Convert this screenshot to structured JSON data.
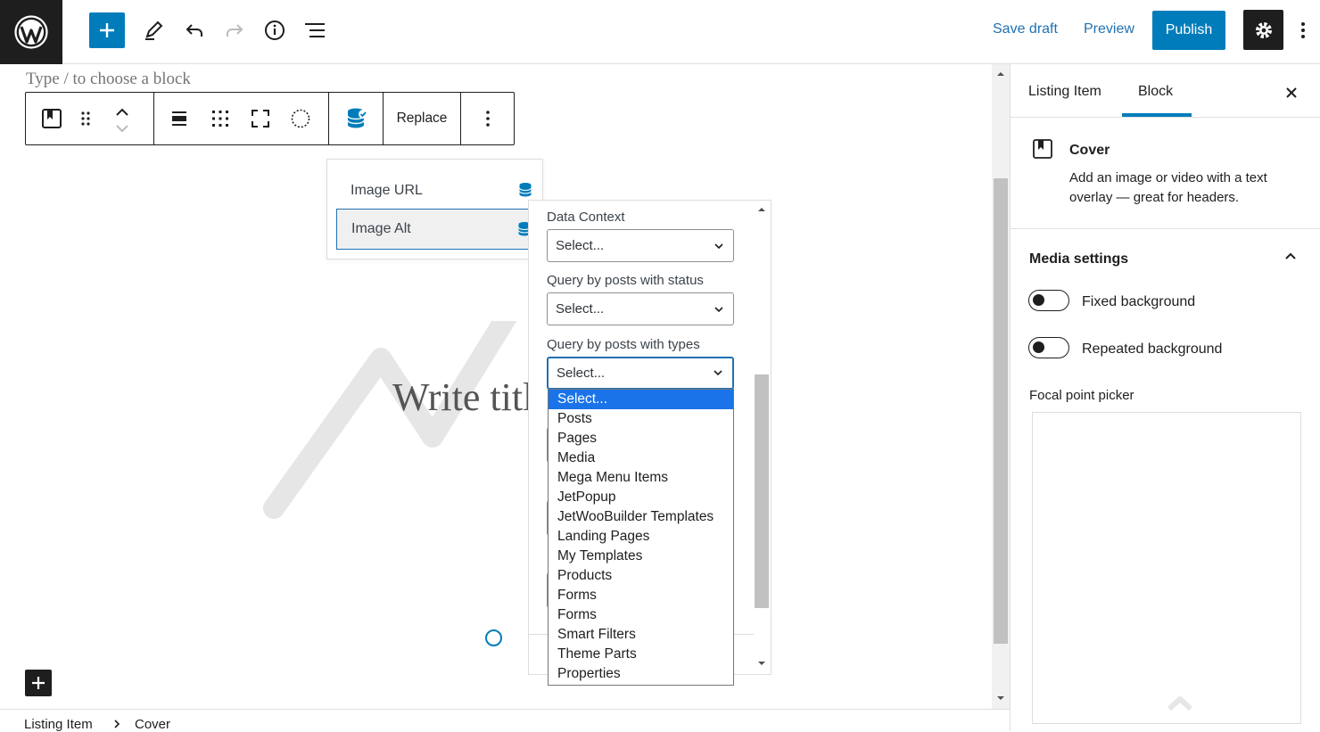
{
  "topbar": {
    "save_draft": "Save draft",
    "preview": "Preview",
    "publish": "Publish",
    "icons": [
      "wordpress-logo",
      "plus-icon",
      "pencil-icon",
      "undo-icon",
      "redo-icon",
      "info-icon",
      "list-view-icon",
      "gear-icon",
      "more-vertical-icon"
    ]
  },
  "editor": {
    "hint": "Type / to choose a block",
    "title_placeholder": "Write title…",
    "toolbar": {
      "replace": "Replace"
    }
  },
  "dynamic_menu": {
    "items": [
      {
        "label": "Image URL",
        "active": false
      },
      {
        "label": "Image Alt",
        "active": true
      }
    ]
  },
  "context_panel": {
    "data_context_label": "Data Context",
    "data_context_value": "Select...",
    "status_label": "Query by posts with status",
    "status_value": "Select...",
    "types_label": "Query by posts with types",
    "types_value": "Select..."
  },
  "dropdown": {
    "options": [
      "Select...",
      "Posts",
      "Pages",
      "Media",
      "Mega Menu Items",
      "JetPopup",
      "JetWooBuilder Templates",
      "Landing Pages",
      "My Templates",
      "Products",
      "Forms",
      "Forms",
      "Smart Filters",
      "Theme Parts",
      "Properties"
    ],
    "selected_index": 0
  },
  "breadcrumb": {
    "items": [
      "Listing Item",
      "Cover"
    ]
  },
  "sidebar": {
    "tabs": [
      "Listing Item",
      "Block"
    ],
    "active_tab": "Block",
    "block_name": "Cover",
    "block_description_line1": "Add an image or video with a text",
    "block_description_line2": "overlay — great for headers.",
    "media_settings_title": "Media settings",
    "fixed_background": "Fixed background",
    "repeated_background": "Repeated background",
    "focal_point_picker": "Focal point picker"
  },
  "colors": {
    "accent": "#007cba",
    "dark": "#1e1e1e",
    "select_highlight": "#1a73e8"
  }
}
